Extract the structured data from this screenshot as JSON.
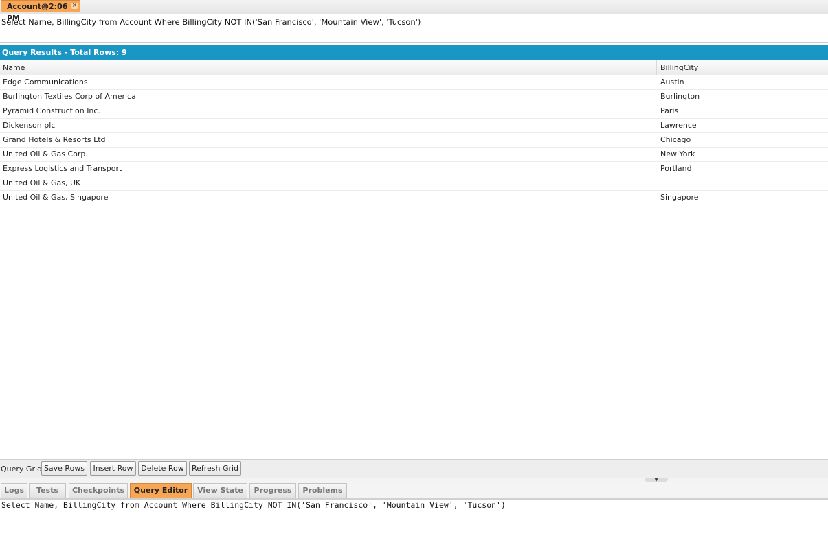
{
  "top_tab": {
    "label": "Account@2:06 PM",
    "close_glyph": "×"
  },
  "query_text": "Select Name, BillingCity from Account Where BillingCity NOT IN('San Francisco', 'Mountain View', 'Tucson')",
  "results_header": "Query Results - Total Rows: 9",
  "grid": {
    "columns": [
      "Name",
      "BillingCity"
    ],
    "rows": [
      [
        "Edge Communications",
        "Austin"
      ],
      [
        "Burlington Textiles Corp of America",
        "Burlington"
      ],
      [
        "Pyramid Construction Inc.",
        "Paris"
      ],
      [
        "Dickenson plc",
        "Lawrence"
      ],
      [
        "Grand Hotels & Resorts Ltd",
        "Chicago"
      ],
      [
        "United Oil & Gas Corp.",
        "New York"
      ],
      [
        "Express Logistics and Transport",
        "Portland"
      ],
      [
        "United Oil & Gas, UK",
        ""
      ],
      [
        "United Oil & Gas, Singapore",
        "Singapore"
      ]
    ]
  },
  "toolbar": {
    "label": "Query Grid:",
    "save_rows": "Save Rows",
    "insert_row": "Insert Row",
    "delete_row": "Delete Row",
    "refresh_grid": "Refresh Grid"
  },
  "bottom_tabs": [
    "Logs",
    "Tests",
    "Checkpoints",
    "Query Editor",
    "View State",
    "Progress",
    "Problems"
  ],
  "active_bottom_tab": "Query Editor",
  "editor_text": "Select Name, BillingCity from Account Where BillingCity NOT IN('San Francisco', 'Mountain View', 'Tucson')",
  "colors": {
    "accent_orange": "#f7a655",
    "header_blue": "#1a96c4"
  }
}
